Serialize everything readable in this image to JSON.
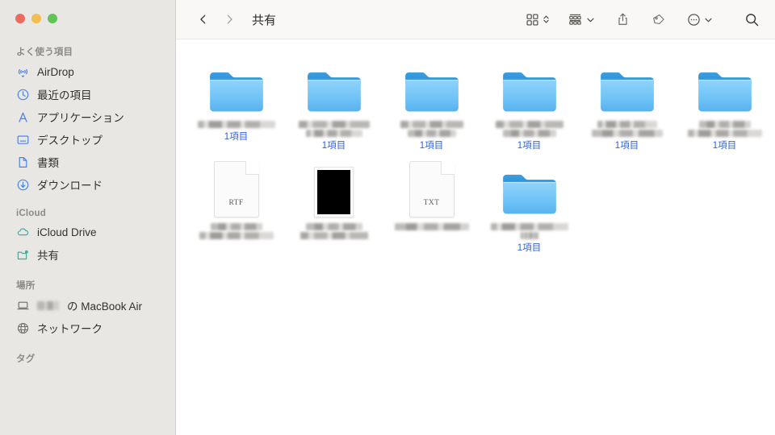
{
  "window": {
    "title": "共有",
    "traffic_lights": [
      {
        "name": "close",
        "color": "#ec6a5f"
      },
      {
        "name": "minimize",
        "color": "#f4bd4f"
      },
      {
        "name": "zoom",
        "color": "#61c454"
      }
    ]
  },
  "sidebar": {
    "sections": [
      {
        "header": "よく使う項目",
        "items": [
          {
            "label": "AirDrop",
            "icon": "airdrop-icon",
            "redacted": false
          },
          {
            "label": "最近の項目",
            "icon": "clock-icon",
            "redacted": false
          },
          {
            "label": "アプリケーション",
            "icon": "applications-icon",
            "redacted": false
          },
          {
            "label": "デスクトップ",
            "icon": "desktop-icon",
            "redacted": false
          },
          {
            "label": "書類",
            "icon": "documents-icon",
            "redacted": false
          },
          {
            "label": "ダウンロード",
            "icon": "downloads-icon",
            "redacted": false
          }
        ]
      },
      {
        "header": "iCloud",
        "items": [
          {
            "label": "iCloud Drive",
            "icon": "cloud-icon",
            "redacted": false
          },
          {
            "label": "共有",
            "icon": "shared-folder-icon",
            "redacted": false
          }
        ]
      },
      {
        "header": "場所",
        "items": [
          {
            "label": " の MacBook Air",
            "icon": "laptop-icon",
            "redacted": true
          },
          {
            "label": "ネットワーク",
            "icon": "network-icon",
            "redacted": false
          }
        ]
      },
      {
        "header": "タグ",
        "items": []
      }
    ]
  },
  "toolbar": {
    "back_label": "戻る",
    "forward_label": "進む",
    "buttons": [
      {
        "name": "icon-view-button",
        "icon": "grid-icon",
        "has_stepper": true
      },
      {
        "name": "group-by-button",
        "icon": "group-rows-icon",
        "has_chevron": true
      },
      {
        "name": "share-button",
        "icon": "share-icon"
      },
      {
        "name": "tag-button",
        "icon": "tag-icon"
      },
      {
        "name": "more-button",
        "icon": "ellipsis-circle-icon",
        "has_chevron": true
      },
      {
        "name": "search-button",
        "icon": "search-icon"
      }
    ]
  },
  "content": {
    "item_count_label": "1項目",
    "rows": [
      [
        {
          "type": "folder",
          "name_lines": 1,
          "count": "1項目"
        },
        {
          "type": "folder",
          "name_lines": 2,
          "count": "1項目"
        },
        {
          "type": "folder",
          "name_lines": 2,
          "count": "1項目"
        },
        {
          "type": "folder",
          "name_lines": 2,
          "count": "1項目"
        },
        {
          "type": "folder",
          "name_lines": 2,
          "count": "1項目"
        },
        {
          "type": "folder",
          "name_lines": 2,
          "count": "1項目"
        }
      ],
      [
        {
          "type": "document",
          "ext": "RTF",
          "name_lines": 2,
          "count": ""
        },
        {
          "type": "image",
          "ext": "",
          "name_lines": 2,
          "count": ""
        },
        {
          "type": "document",
          "ext": "TXT",
          "name_lines": 1,
          "count": ""
        },
        {
          "type": "folder",
          "name_lines": 2,
          "count": "1項目"
        }
      ]
    ]
  },
  "colors": {
    "sidebar_bg": "#e9e7e4",
    "toolbar_bg": "#faf8f7",
    "content_bg": "#ffffff",
    "folder_blue": "#62b6f2",
    "count_blue": "#2f63d8",
    "accent_blue": "#3b7ae0"
  }
}
